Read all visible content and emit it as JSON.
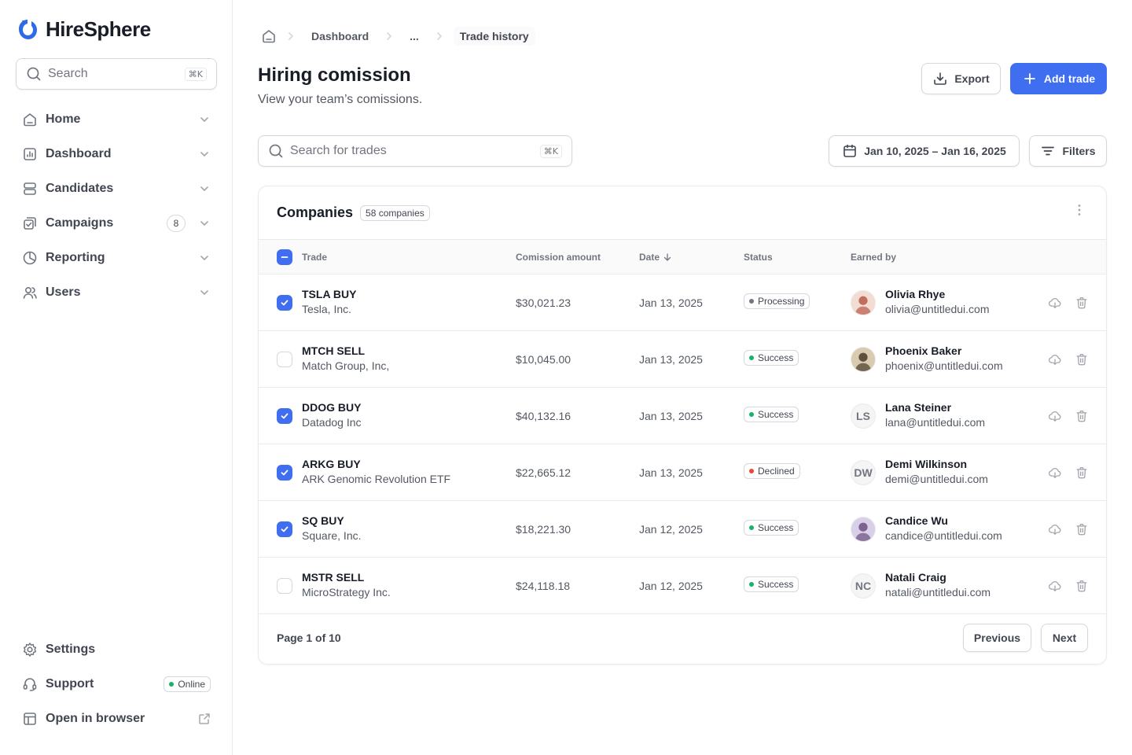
{
  "app": {
    "name": "HireSphere",
    "brand_color": "#3f6ef0"
  },
  "sidebar": {
    "search": {
      "placeholder": "Search",
      "shortcut": "⌘K"
    },
    "items": [
      {
        "label": "Home",
        "icon": "home-icon"
      },
      {
        "label": "Dashboard",
        "icon": "bar-chart-icon"
      },
      {
        "label": "Candidates",
        "icon": "layers-icon"
      },
      {
        "label": "Campaigns",
        "icon": "check-square-icon",
        "badge": "8"
      },
      {
        "label": "Reporting",
        "icon": "pie-chart-icon"
      },
      {
        "label": "Users",
        "icon": "users-icon"
      }
    ],
    "bottom": [
      {
        "label": "Settings",
        "icon": "gear-icon"
      },
      {
        "label": "Support",
        "icon": "headset-icon",
        "status": "Online"
      },
      {
        "label": "Open in browser",
        "icon": "layout-icon"
      }
    ]
  },
  "breadcrumb": {
    "items": [
      "Dashboard",
      "...",
      "Trade history"
    ]
  },
  "header": {
    "title": "Hiring comission",
    "subtitle": "View your team’s comissions.",
    "export_label": "Export",
    "add_label": "Add trade"
  },
  "toolbar": {
    "search_placeholder": "Search for trades",
    "search_shortcut": "⌘K",
    "date_range": "Jan 10, 2025 – Jan 16, 2025",
    "filters_label": "Filters"
  },
  "table": {
    "title": "Companies",
    "count": "58 companies",
    "columns": [
      "Trade",
      "Comission amount",
      "Date",
      "Status",
      "Earned by"
    ],
    "rows": [
      {
        "checked": true,
        "trade": "TSLA BUY",
        "company": "Tesla, Inc.",
        "amount": "$30,021.23",
        "date": "Jan 13, 2025",
        "status": "Processing",
        "status_color": "#717680",
        "name": "Olivia Rhye",
        "email": "olivia@untitledui.com",
        "avatar": "photo",
        "avatar_colors": [
          "#f3ddd2",
          "#b85a48"
        ]
      },
      {
        "checked": false,
        "trade": "MTCH SELL",
        "company": "Match Group, Inc,",
        "amount": "$10,045.00",
        "date": "Jan 13, 2025",
        "status": "Success",
        "status_color": "#17b26a",
        "name": "Phoenix Baker",
        "email": "phoenix@untitledui.com",
        "avatar": "photo",
        "avatar_colors": [
          "#d8cbb0",
          "#4a3a2a"
        ]
      },
      {
        "checked": true,
        "trade": "DDOG BUY",
        "company": "Datadog Inc",
        "amount": "$40,132.16",
        "date": "Jan 13, 2025",
        "status": "Success",
        "status_color": "#17b26a",
        "name": "Lana Steiner",
        "email": "lana@untitledui.com",
        "initials": "LS"
      },
      {
        "checked": true,
        "trade": "ARKG BUY",
        "company": "ARK Genomic Revolution ETF",
        "amount": "$22,665.12",
        "date": "Jan 13, 2025",
        "status": "Declined",
        "status_color": "#f04438",
        "name": "Demi Wilkinson",
        "email": "demi@untitledui.com",
        "initials": "DW"
      },
      {
        "checked": true,
        "trade": "SQ BUY",
        "company": "Square, Inc.",
        "amount": "$18,221.30",
        "date": "Jan 12, 2025",
        "status": "Success",
        "status_color": "#17b26a",
        "name": "Candice Wu",
        "email": "candice@untitledui.com",
        "avatar": "photo",
        "avatar_colors": [
          "#d9cfe8",
          "#6b4f80"
        ]
      },
      {
        "checked": false,
        "trade": "MSTR SELL",
        "company": "MicroStrategy Inc.",
        "amount": "$24,118.18",
        "date": "Jan 12, 2025",
        "status": "Success",
        "status_color": "#17b26a",
        "name": "Natali Craig",
        "email": "natali@untitledui.com",
        "initials": "NC"
      }
    ]
  },
  "pagination": {
    "label": "Page 1 of 10",
    "prev_label": "Previous",
    "next_label": "Next"
  }
}
